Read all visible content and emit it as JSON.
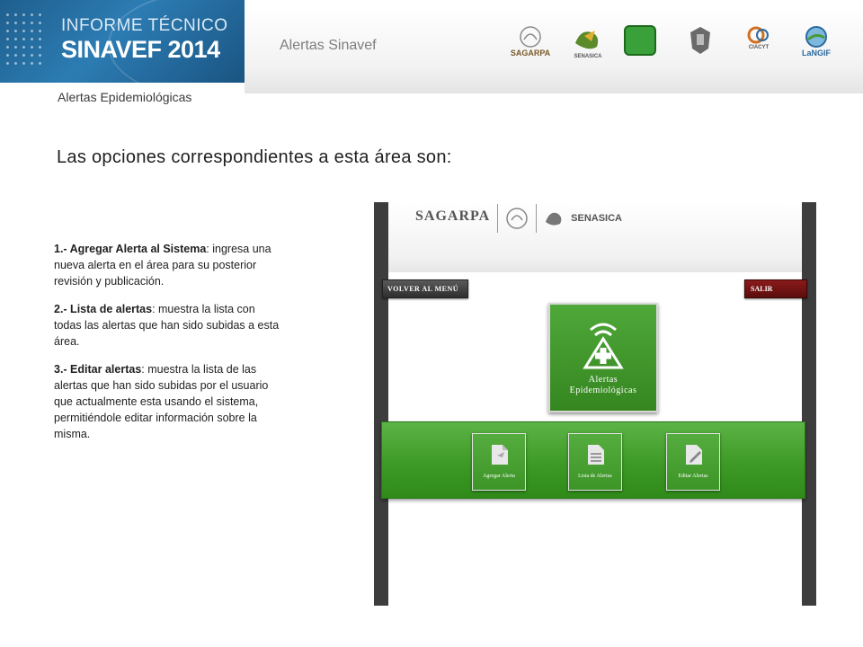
{
  "banner": {
    "line1": "INFORME TÉCNICO",
    "line2": "SINAVEF 2014"
  },
  "header": {
    "title": "Alertas Sinavef",
    "logos": [
      {
        "name": "SAGARPA",
        "color": "#7a5a2a"
      },
      {
        "name": "SENASICA",
        "color": "#3a7a2a"
      },
      {
        "name": "SINAVEF",
        "color": "#3a9a3a"
      },
      {
        "name": "UASLP",
        "color": "#5a5a5a"
      },
      {
        "name": "CIACYT",
        "color": "#d07020"
      },
      {
        "name": "LaNGIF",
        "color": "#2a6aa0"
      }
    ]
  },
  "subtitle": "Alertas Epidemiológicas",
  "intro": "Las opciones correspondientes a esta área son:",
  "options": [
    {
      "title": "1.- Agregar Alerta al Sistema",
      "text": ": ingresa una nueva alerta en el área para su posterior revisión y publicación."
    },
    {
      "title": "2.- Lista de alertas",
      "text": ": muestra la lista con todas las alertas que han sido subidas a esta área."
    },
    {
      "title": "3.- Editar alertas",
      "text": ": muestra la lista de las alertas que han sido subidas por el usuario que actualmente esta usando el sistema, permitiéndole editar información sobre la misma."
    }
  ],
  "app": {
    "logo_sagarpa": "SAGARPA",
    "logo_senasica": "SENASICA",
    "back_button": "VOLVER AL MENÚ",
    "exit_button": "SALIR",
    "main_tile": {
      "line1": "Alertas",
      "line2": "Epidemiológicas"
    },
    "sub_tiles": [
      {
        "label": "Agregar Alerta"
      },
      {
        "label": "Lista de Alertas"
      },
      {
        "label": "Editar Alertas"
      }
    ]
  }
}
